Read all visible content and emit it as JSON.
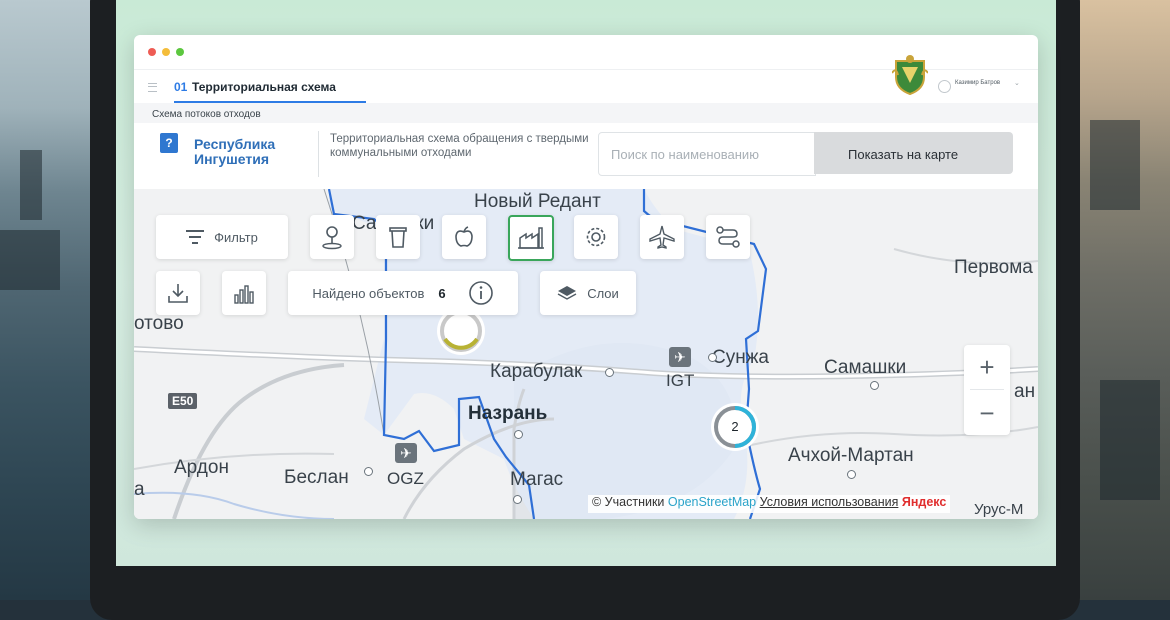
{
  "app": {
    "tab_number": "01",
    "tab_title": "Территориальная схема",
    "user_name": "Казимир Батров",
    "subheader": "Схема потоков отходов"
  },
  "region": {
    "name": "Республика Ингушетия",
    "scheme_description": "Территориальная схема обращения с твердыми коммунальными отходами"
  },
  "search": {
    "placeholder": "Поиск по наименованию",
    "button_label": "Показать на карте"
  },
  "toolbar": {
    "filter_label": "Фильтр",
    "found_label": "Найдено объектов",
    "found_count": "6",
    "layers_label": "Слои",
    "icons": [
      "location-pin-icon",
      "trash-bin-icon",
      "apple-icon",
      "factory-icon",
      "gear-icon",
      "airplane-icon",
      "route-icon",
      "download-icon",
      "bar-chart-icon",
      "info-icon",
      "layers-icon"
    ]
  },
  "map": {
    "places": {
      "novy_redant": "Новый Редант",
      "samashki_left": "Самашки",
      "pervomayskoe": "Первома",
      "otovo": "отово",
      "karabulak": "Карабулак",
      "igt": "IGT",
      "sunzha": "Сунжа",
      "samashki": "Самашки",
      "nazran": "Назрань",
      "ardon": "Ардон",
      "beslan": "Беслан",
      "ogz": "OGZ",
      "magas": "Магас",
      "achkhoy_martan": "Ачхой-Мартан",
      "edge_a": "а",
      "edge_right": "ан",
      "urus": "Урус-М"
    },
    "road_badge": "E50",
    "cluster_count": "2",
    "zoom_in": "+",
    "zoom_out": "−",
    "attribution": {
      "prefix": "© Участники",
      "osm": "OpenStreetMap",
      "terms": "Условия использования",
      "yandex": "Яндекс"
    }
  }
}
